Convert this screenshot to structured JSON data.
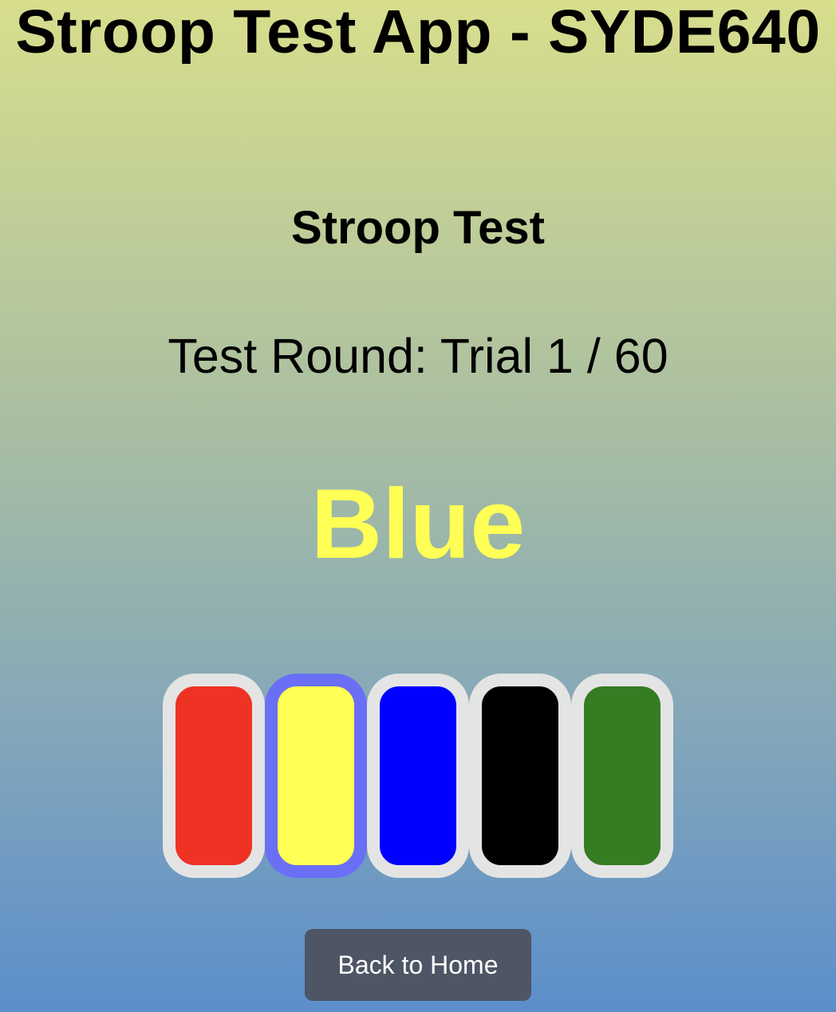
{
  "app": {
    "title": "Stroop Test App - SYDE640"
  },
  "test": {
    "title": "Stroop Test",
    "trial_text": "Test Round: Trial 1 / 60",
    "stimulus_word": "Blue",
    "stimulus_color": "#ffff55"
  },
  "choices": [
    {
      "name": "red",
      "color": "#ee3224",
      "selected": false
    },
    {
      "name": "yellow",
      "color": "#ffff55",
      "selected": true
    },
    {
      "name": "blue",
      "color": "#0000ff",
      "selected": false
    },
    {
      "name": "black",
      "color": "#000000",
      "selected": false
    },
    {
      "name": "green",
      "color": "#367c22",
      "selected": false
    }
  ],
  "actions": {
    "back_label": "Back to Home"
  },
  "colors": {
    "choice_border": "#e4e4e4",
    "selected_border": "#6a6ff5",
    "button_bg": "#4e5565"
  }
}
